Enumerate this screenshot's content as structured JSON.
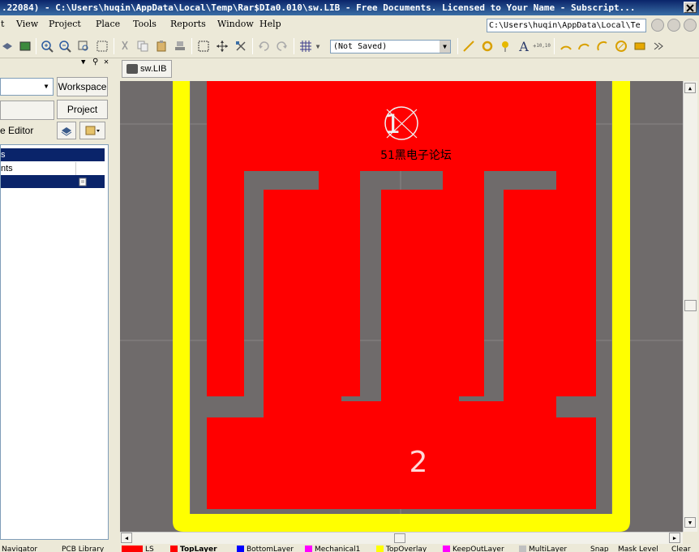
{
  "window": {
    "title": ".22084) - C:\\Users\\huqin\\AppData\\Local\\Temp\\Rar$DIa0.010\\sw.LIB - Free Documents. Licensed to Your Name - Subscript..."
  },
  "menu": {
    "items": [
      {
        "label": "t"
      },
      {
        "label": "View"
      },
      {
        "label": "Project"
      },
      {
        "label": "Place"
      },
      {
        "label": "Tools"
      },
      {
        "label": "Reports"
      },
      {
        "label": "Window"
      },
      {
        "label": "Help"
      }
    ],
    "path_value": "C:\\Users\\huqin\\AppData\\Local\\Te"
  },
  "toolbar": {
    "variant_value": "(Not Saved)"
  },
  "left_panel": {
    "workspace_button": "Workspace",
    "project_button": "Project",
    "editor_label": "e Editor",
    "tree_rows": [
      {
        "label": "s"
      },
      {
        "label": "nts"
      },
      {
        "label": ""
      }
    ]
  },
  "document": {
    "tab_label": "sw.LIB"
  },
  "pcb": {
    "component_label": "51黑电子论坛",
    "pad1_number": "1",
    "pad2_number": "2",
    "colors": {
      "background": "#6f6b6b",
      "top_layer": "#ff0000",
      "top_overlay": "#ffff00",
      "grid": "#8a8686"
    }
  },
  "layer_tabs": [
    {
      "label": "LS",
      "color": "#ff0000"
    },
    {
      "label": "TopLayer",
      "color": "#ff0000"
    },
    {
      "label": "BottomLayer",
      "color": "#0000ff"
    },
    {
      "label": "Mechanical1",
      "color": "#ff00ff"
    },
    {
      "label": "TopOverlay",
      "color": "#ffff00"
    },
    {
      "label": "KeepOutLayer",
      "color": "#ff00ff"
    },
    {
      "label": "MultiLayer",
      "color": "#c0c0c0"
    }
  ],
  "status_buttons": {
    "snap": "Snap",
    "mask_level": "Mask Level",
    "clear": "Clear"
  },
  "bottom_panel_tabs": {
    "navigator": "Navigator",
    "pcb_library": "PCB Library"
  }
}
